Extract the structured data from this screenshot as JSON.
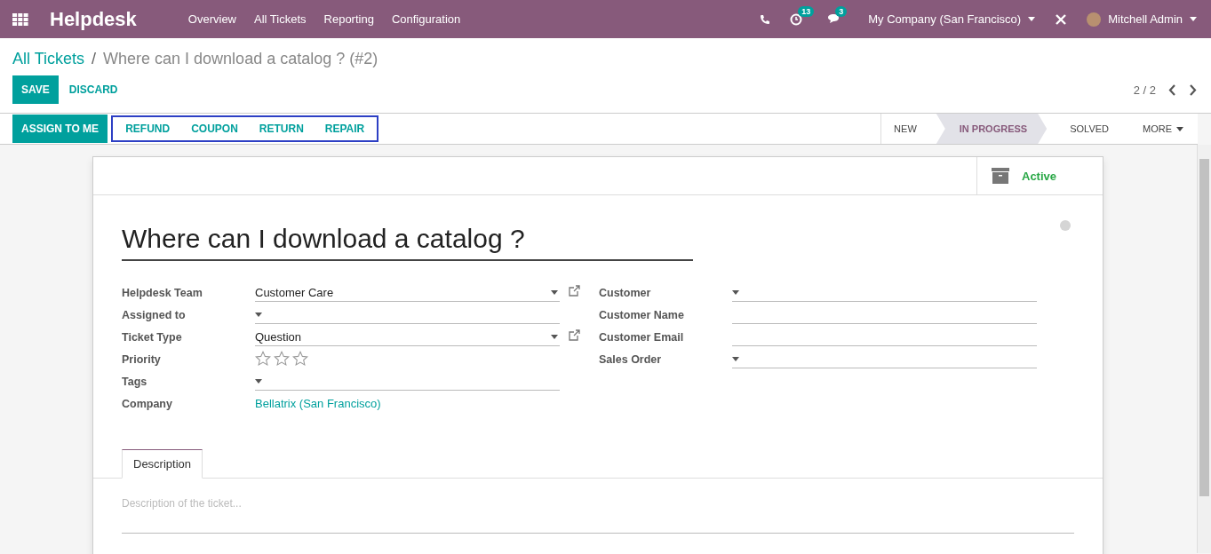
{
  "navbar": {
    "app_name": "Helpdesk",
    "menu": [
      "Overview",
      "All Tickets",
      "Reporting",
      "Configuration"
    ],
    "activity_count": "13",
    "message_count": "3",
    "company": "My Company (San Francisco)",
    "user": "Mitchell Admin"
  },
  "breadcrumb": {
    "parent": "All Tickets",
    "separator": "/",
    "current": "Where can I download a catalog ? (#2)"
  },
  "actions": {
    "save": "SAVE",
    "discard": "DISCARD"
  },
  "pager": "2 / 2",
  "header": {
    "primary_button": "ASSIGN TO ME",
    "highlighted_buttons": [
      "REFUND",
      "COUPON",
      "RETURN",
      "REPAIR"
    ]
  },
  "stages": [
    {
      "label": "NEW",
      "selected": false
    },
    {
      "label": "IN PROGRESS",
      "selected": true
    },
    {
      "label": "SOLVED",
      "selected": false
    }
  ],
  "more": "MORE",
  "active_button": "Active",
  "title": "Where can I download a catalog ?",
  "fields_left": [
    {
      "label": "Helpdesk Team",
      "kind": "select_link",
      "value": "Customer Care"
    },
    {
      "label": "Assigned to",
      "kind": "select"
    },
    {
      "label": "Ticket Type",
      "kind": "select_link",
      "value": "Question"
    },
    {
      "label": "Priority",
      "kind": "stars",
      "stars": 0
    },
    {
      "label": "Tags",
      "kind": "select"
    },
    {
      "label": "Company",
      "kind": "link",
      "value": "Bellatrix (San Francisco)"
    }
  ],
  "fields_right": [
    {
      "label": "Customer",
      "kind": "select"
    },
    {
      "label": "Customer Name",
      "kind": "text"
    },
    {
      "label": "Customer Email",
      "kind": "text"
    },
    {
      "label": "Sales Order",
      "kind": "select"
    }
  ],
  "tabs": [
    {
      "label": "Description",
      "selected": true
    }
  ],
  "description": {
    "placeholder": "Description of the ticket..."
  }
}
